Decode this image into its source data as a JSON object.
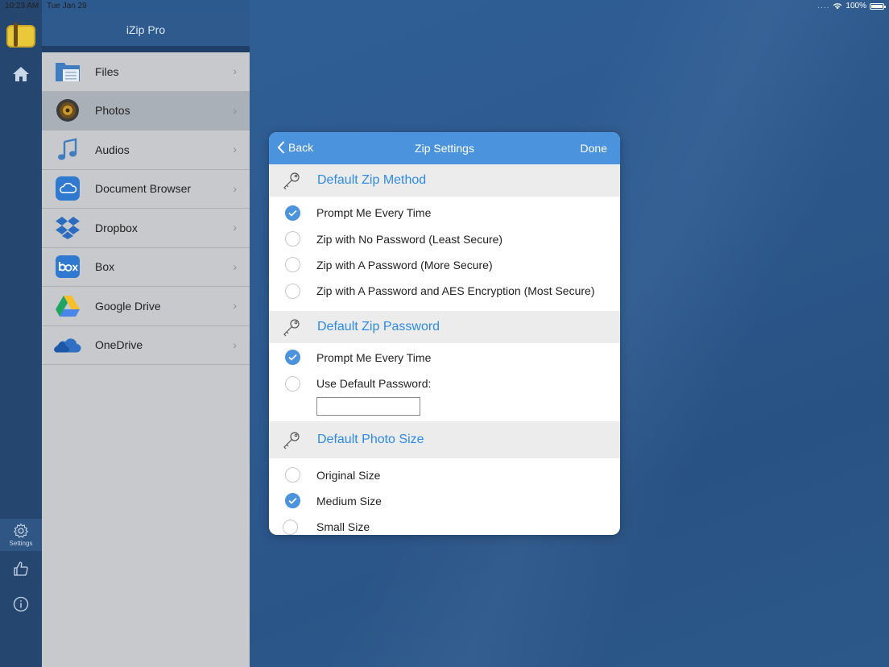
{
  "status_bar": {
    "time": "10:23 AM",
    "date": "Tue Jan 29",
    "dots": "....",
    "battery": "100%"
  },
  "rail": {
    "settings_label": "Settings"
  },
  "panel": {
    "title": "iZip Pro",
    "items": [
      {
        "label": "Files",
        "icon": "folder-icon",
        "selected": false
      },
      {
        "label": "Photos",
        "icon": "photos-icon",
        "selected": true
      },
      {
        "label": "Audios",
        "icon": "music-note-icon",
        "selected": false
      },
      {
        "label": "Document Browser",
        "icon": "cloud-icon",
        "selected": false
      },
      {
        "label": "Dropbox",
        "icon": "dropbox-icon",
        "selected": false
      },
      {
        "label": "Box",
        "icon": "box-icon",
        "selected": false
      },
      {
        "label": "Google Drive",
        "icon": "google-drive-icon",
        "selected": false
      },
      {
        "label": "OneDrive",
        "icon": "onedrive-icon",
        "selected": false
      }
    ]
  },
  "modal": {
    "back_label": "Back",
    "title": "Zip Settings",
    "done_label": "Done",
    "sections": {
      "method": {
        "title": "Default Zip Method",
        "options": [
          {
            "label": "Prompt Me Every Time",
            "checked": true
          },
          {
            "label": "Zip with No Password (Least Secure)",
            "checked": false
          },
          {
            "label": "Zip with A Password (More Secure)",
            "checked": false
          },
          {
            "label": "Zip with A Password and AES Encryption (Most Secure)",
            "checked": false
          }
        ]
      },
      "password": {
        "title": "Default Zip Password",
        "options": [
          {
            "label": "Prompt Me Every Time",
            "checked": true
          },
          {
            "label": "Use Default Password:",
            "checked": false
          }
        ],
        "password_value": ""
      },
      "photo_size": {
        "title": "Default Photo Size",
        "options": [
          {
            "label": "Original Size",
            "checked": false
          },
          {
            "label": "Medium Size",
            "checked": true
          },
          {
            "label": "Small Size",
            "checked": false
          }
        ]
      }
    }
  },
  "colors": {
    "accent": "#4c93de",
    "section_title": "#2e8ae6",
    "rail_bg": "#24466f",
    "panel_bg": "#c8c9cc"
  }
}
